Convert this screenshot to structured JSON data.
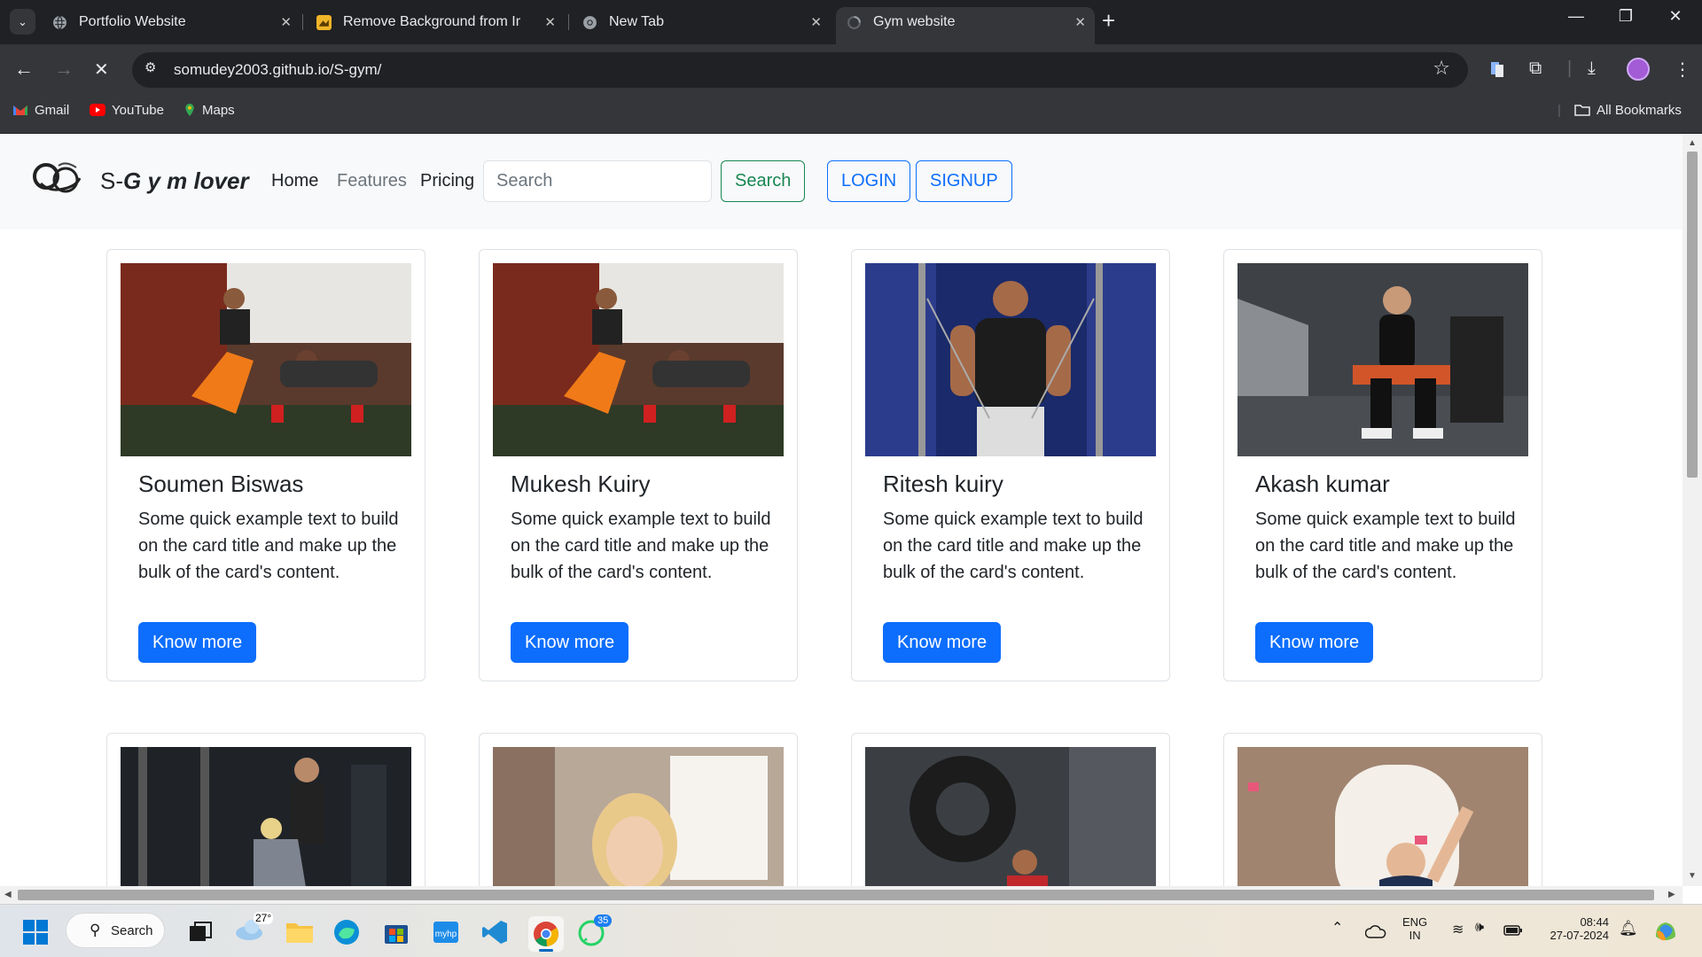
{
  "browser": {
    "tabs": [
      {
        "title": "Portfolio Website",
        "close": "✕"
      },
      {
        "title": "Remove Background from Imag",
        "close": "✕"
      },
      {
        "title": "New Tab",
        "close": "✕"
      },
      {
        "title": "Gym website",
        "close": "✕"
      }
    ],
    "new_tab": "+",
    "url": "somudey2003.github.io/S-gym/",
    "bookmarks": [
      "Gmail",
      "YouTube",
      "Maps"
    ],
    "all_bookmarks": "All Bookmarks"
  },
  "site": {
    "brand_prefix": "S-",
    "brand_rest": "G y m lover",
    "nav": [
      "Home",
      "Features",
      "Pricing"
    ],
    "search_placeholder": "Search",
    "search_button": "Search",
    "login": "LOGIN",
    "signup": "SIGNUP"
  },
  "cards": [
    {
      "name": "Soumen Biswas",
      "text": "Some quick example text to build on the card title and make up the bulk of the card's content.",
      "button": "Know more"
    },
    {
      "name": "Mukesh Kuiry",
      "text": "Some quick example text to build on the card title and make up the bulk of the card's content.",
      "button": "Know more"
    },
    {
      "name": "Ritesh kuiry",
      "text": "Some quick example text to build on the card title and make up the bulk of the card's content.",
      "button": "Know more"
    },
    {
      "name": "Akash kumar",
      "text": "Some quick example text to build on the card title and make up the bulk of the card's content.",
      "button": "Know more"
    }
  ],
  "taskbar": {
    "search": "Search",
    "weather": "27°",
    "whatsapp_badge": "35",
    "lang_top": "ENG",
    "lang_bottom": "IN",
    "time": "08:44",
    "date": "27-07-2024"
  },
  "colors": {
    "primary": "#0d6efd",
    "success": "#198754",
    "chrome_dark": "#202124",
    "chrome_mid": "#35363a"
  }
}
